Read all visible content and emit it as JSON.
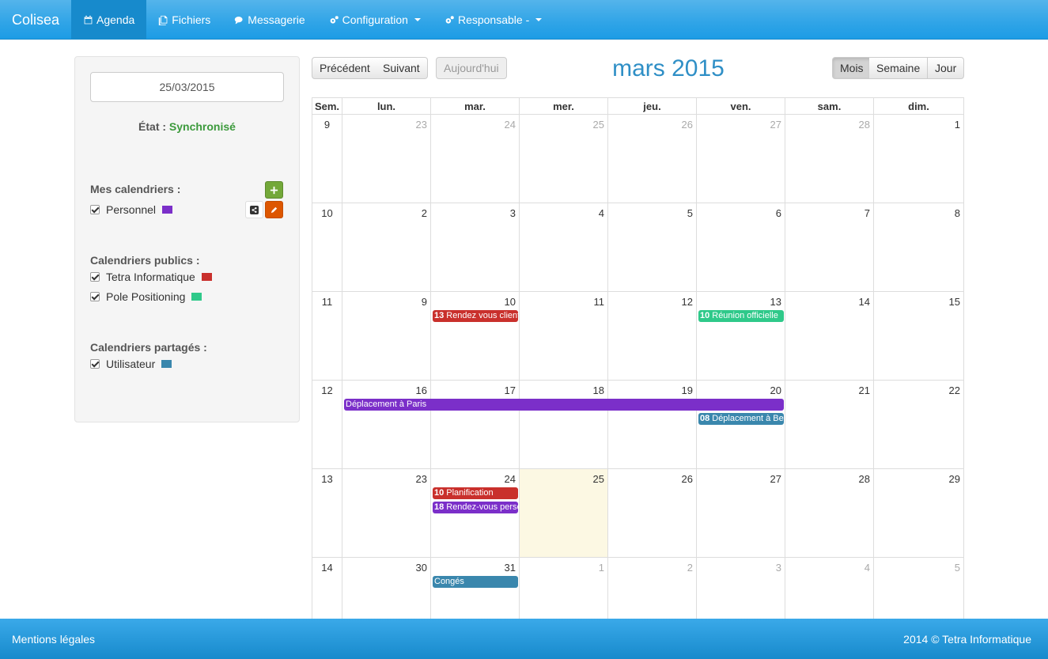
{
  "navbar": {
    "brand": "Colisea",
    "items": [
      {
        "label": "Agenda",
        "icon": "calendar-icon",
        "active": true
      },
      {
        "label": "Fichiers",
        "icon": "files-icon"
      },
      {
        "label": "Messagerie",
        "icon": "comments-icon"
      },
      {
        "label": "Configuration",
        "icon": "cogs-icon"
      },
      {
        "label": "Responsable -",
        "icon": "cogs-icon"
      }
    ]
  },
  "sidebar": {
    "date_value": "25/03/2015",
    "etat_label": "État :",
    "etat_value": "Synchronisé",
    "my_title": "Mes calendriers :",
    "my_calendars": [
      {
        "label": "Personnel",
        "color": "#7b2fc9"
      }
    ],
    "public_title": "Calendriers publics :",
    "public_calendars": [
      {
        "label": "Tetra Informatique",
        "color": "#c9302c"
      },
      {
        "label": "Pole Positioning",
        "color": "#2fc98a"
      }
    ],
    "shared_title": "Calendriers partagés :",
    "shared_calendars": [
      {
        "label": "Utilisateur",
        "color": "#3a87ad"
      }
    ]
  },
  "calendar": {
    "prev_label": "Précédent",
    "next_label": "Suivant",
    "today_label": "Aujourd'hui",
    "title": "mars 2015",
    "view_month": "Mois",
    "view_week": "Semaine",
    "view_day": "Jour",
    "headers": [
      "Sem.",
      "lun.",
      "mar.",
      "mer.",
      "jeu.",
      "ven.",
      "sam.",
      "dim."
    ],
    "weeks": [
      {
        "num": "9",
        "days": [
          {
            "d": "23",
            "o": true
          },
          {
            "d": "24",
            "o": true
          },
          {
            "d": "25",
            "o": true
          },
          {
            "d": "26",
            "o": true
          },
          {
            "d": "27",
            "o": true
          },
          {
            "d": "28",
            "o": true
          },
          {
            "d": "1"
          }
        ]
      },
      {
        "num": "10",
        "days": [
          {
            "d": "2"
          },
          {
            "d": "3"
          },
          {
            "d": "4"
          },
          {
            "d": "5"
          },
          {
            "d": "6"
          },
          {
            "d": "7"
          },
          {
            "d": "8"
          }
        ]
      },
      {
        "num": "11",
        "days": [
          {
            "d": "9"
          },
          {
            "d": "10"
          },
          {
            "d": "11"
          },
          {
            "d": "12"
          },
          {
            "d": "13"
          },
          {
            "d": "14"
          },
          {
            "d": "15"
          }
        ]
      },
      {
        "num": "12",
        "days": [
          {
            "d": "16"
          },
          {
            "d": "17"
          },
          {
            "d": "18"
          },
          {
            "d": "19"
          },
          {
            "d": "20"
          },
          {
            "d": "21"
          },
          {
            "d": "22"
          }
        ]
      },
      {
        "num": "13",
        "days": [
          {
            "d": "23"
          },
          {
            "d": "24"
          },
          {
            "d": "25",
            "today": true
          },
          {
            "d": "26"
          },
          {
            "d": "27"
          },
          {
            "d": "28"
          },
          {
            "d": "29"
          }
        ]
      },
      {
        "num": "14",
        "days": [
          {
            "d": "30"
          },
          {
            "d": "31"
          },
          {
            "d": "1",
            "o": true
          },
          {
            "d": "2",
            "o": true
          },
          {
            "d": "3",
            "o": true
          },
          {
            "d": "4",
            "o": true
          },
          {
            "d": "5",
            "o": true
          }
        ]
      }
    ],
    "events": [
      {
        "week": 2,
        "day": 1,
        "span": 1,
        "slot": 0,
        "time": "13",
        "title": "Rendez vous client",
        "color": "#c9302c"
      },
      {
        "week": 2,
        "day": 4,
        "span": 1,
        "slot": 0,
        "time": "10",
        "title": "Réunion officielle",
        "color": "#2fc98a"
      },
      {
        "week": 3,
        "day": 0,
        "span": 5,
        "slot": 0,
        "time": "",
        "title": "Déplacement à Paris",
        "color": "#7b2fc9"
      },
      {
        "week": 3,
        "day": 4,
        "span": 1,
        "slot": 1,
        "time": "08",
        "title": "Déplacement à Berlin",
        "color": "#3a87ad"
      },
      {
        "week": 4,
        "day": 1,
        "span": 1,
        "slot": 0,
        "time": "10",
        "title": "Planification",
        "color": "#c9302c"
      },
      {
        "week": 4,
        "day": 1,
        "span": 1,
        "slot": 1,
        "time": "18",
        "title": "Rendez-vous personnel",
        "color": "#7b2fc9"
      },
      {
        "week": 5,
        "day": 1,
        "span": 1,
        "slot": 0,
        "time": "",
        "title": "Congés",
        "color": "#3a87ad"
      }
    ]
  },
  "footer": {
    "left": "Mentions légales",
    "right": "2014 © Tetra Informatique"
  }
}
